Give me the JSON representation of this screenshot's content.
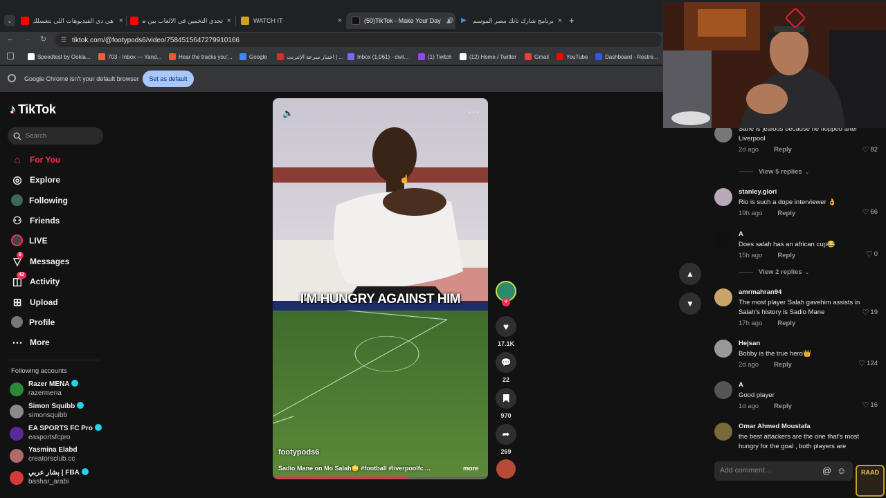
{
  "browser": {
    "tabs": [
      {
        "title": "هي دي الفيديوهات اللي بتغسلك",
        "fav": "youtube"
      },
      {
        "title": "تحدي التخمين في الالعاب بين صـ",
        "fav": "youtube"
      },
      {
        "title": "WATCH IT",
        "fav": "watchit"
      },
      {
        "title": "(50)TikTok - Make Your Day",
        "fav": "tiktok",
        "active": true
      },
      {
        "title": "برنامج شارك تانك مصر الموسم ال",
        "fav": "play"
      }
    ],
    "url": "tiktok.com/@footypods6/video/7584515647279910166",
    "bookmarks": [
      "Speedtest by Ookla...",
      "703 - Inbox — Yand...",
      "Hear the tracks you'...",
      "Google",
      "اختبار سرعة الإنترنت | ...",
      "Inbox (1,061) - civil...",
      "(1) Twitch",
      "(12) Home / Twitter",
      "Gmail",
      "YouTube",
      "Dashboard - Restre..."
    ],
    "bookmark_colors": [
      "#ffffff",
      "#f25f3a",
      "#f2553a",
      "#4285f4",
      "#d32f2f",
      "#7b68ee",
      "#9146ff",
      "#ffffff",
      "#ea4335",
      "#ff0000",
      "#2d5bd6"
    ],
    "infobar": {
      "message": "Google Chrome isn't your default browser",
      "button": "Set as default"
    }
  },
  "sidebar": {
    "logo": "TikTok",
    "search_placeholder": "Search",
    "nav": [
      {
        "label": "For You",
        "icon": "home-icon",
        "active": true
      },
      {
        "label": "Explore",
        "icon": "compass-icon"
      },
      {
        "label": "Following",
        "icon": "following-avatar-icon"
      },
      {
        "label": "Friends",
        "icon": "friends-icon"
      },
      {
        "label": "LIVE",
        "icon": "live-icon"
      },
      {
        "label": "Messages",
        "icon": "messages-icon",
        "badge": "8"
      },
      {
        "label": "Activity",
        "icon": "activity-icon",
        "badge": "42"
      },
      {
        "label": "Upload",
        "icon": "upload-icon"
      },
      {
        "label": "Profile",
        "icon": "profile-avatar-icon"
      },
      {
        "label": "More",
        "icon": "more-dots-icon"
      }
    ],
    "following_title": "Following accounts",
    "accounts": [
      {
        "name": "Razer MENA",
        "handle": "razermena",
        "verified": true,
        "color": "#2a8a3a"
      },
      {
        "name": "Simon Squibb",
        "handle": "simonsquibb",
        "verified": true,
        "color": "#8a8a8a"
      },
      {
        "name": "EA SPORTS FC Pro",
        "handle": "easportsfcpro",
        "verified": true,
        "color": "#5a2a9a"
      },
      {
        "name": "Yasmina Elabd",
        "handle": "creatorsclub.cc",
        "verified": false,
        "color": "#b06a6a"
      },
      {
        "name": "بشار عربي | FBA",
        "handle": "bashar_arabi",
        "verified": true,
        "color": "#d43a3a"
      }
    ]
  },
  "video": {
    "caption_overlay": "I'M HUNGRY AGAINST HIM",
    "author": "footypods6",
    "description": "Sadio Mane on Mo Salah😳 #football #liverpoolfc ...",
    "more": "more",
    "progress": 0.63,
    "likes": "17.1K",
    "comments": "22",
    "saves": "970",
    "shares": "269"
  },
  "comments": [
    {
      "user": "",
      "text": "Sane is jealous because he flopped after Liverpool",
      "time": "2d ago",
      "likes": "82",
      "color": "#777"
    },
    {
      "user": "stanley.glori",
      "text": "Rio is such a dope interviewer 👌",
      "time": "19h ago",
      "likes": "66",
      "color": "#b8a8b8"
    },
    {
      "user": "A",
      "text": "Does salah has an african cup😂",
      "time": "15h ago",
      "likes": "0",
      "color": "#111"
    },
    {
      "user": "amrmahran94",
      "text": "The most player Salah gavehim assists in Salah's history is Sadio Mane",
      "time": "17h ago",
      "likes": "19",
      "color": "#c9a56a"
    },
    {
      "user": "Hejsan",
      "text": "Bobby is the true hero👑",
      "time": "2d ago",
      "likes": "124",
      "color": "#999"
    },
    {
      "user": "A",
      "text": "Good player",
      "time": "1d ago",
      "likes": "16",
      "color": "#555"
    },
    {
      "user": "Omar Ahmed Moustafa",
      "text": "the best attackers are the one that's most hungry for the goal , both players are",
      "time": "",
      "likes": "",
      "color": "#7a6a3a"
    }
  ],
  "view_replies": [
    "View 5 replies",
    "View 2 replies"
  ],
  "reply_label": "Reply",
  "add_comment_placeholder": "Add comment...",
  "streamer_logo": "RAAD"
}
